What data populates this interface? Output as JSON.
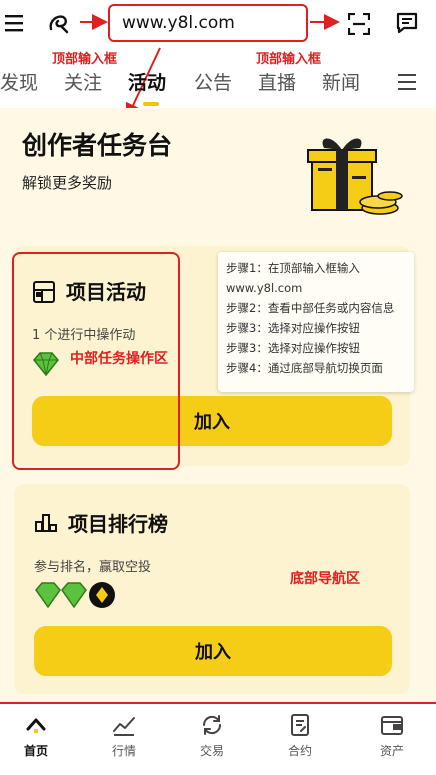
{
  "topbar": {
    "menu_icon": "hamburger-icon",
    "logo_icon": "swirl-logo-icon",
    "url": "www.y8l.com",
    "scan_icon": "scan-icon",
    "message_icon": "message-icon"
  },
  "annotations": {
    "top_input_left": "顶部输入框",
    "top_input_right": "顶部输入框",
    "middle_area": "中部任务操作区",
    "bottom_nav": "底部导航区",
    "color": "#e02020"
  },
  "tabs": [
    {
      "label": "发现"
    },
    {
      "label": "关注"
    },
    {
      "label": "活动"
    },
    {
      "label": "公告"
    },
    {
      "label": "直播"
    },
    {
      "label": "新闻"
    }
  ],
  "tabs_menu_icon": "hamburger-icon",
  "hero": {
    "title": "创作者任务台",
    "subtitle": "解锁更多奖励"
  },
  "cards": [
    {
      "icon": "project-board-icon",
      "title": "项目活动",
      "desc": "1 个进行中操作动",
      "button": "加入"
    },
    {
      "icon": "ranking-bars-icon",
      "title": "项目排行榜",
      "desc": "参与排名，赢取空投",
      "button": "加入"
    }
  ],
  "steps": [
    "步骤1：在顶部输入框输入",
    "www.y8l.com",
    "步骤2：查看中部任务或内容信息",
    "步骤3：选择对应操作按钮",
    "步骤3：选择对应操作按钮",
    "步骤4：通过底部导航切换页面"
  ],
  "bottom_nav": [
    {
      "label": "首页",
      "icon": "home-chevron-icon",
      "active": true
    },
    {
      "label": "行情",
      "icon": "chart-line-icon",
      "active": false
    },
    {
      "label": "交易",
      "icon": "exchange-icon",
      "active": false
    },
    {
      "label": "合约",
      "icon": "contract-doc-icon",
      "active": false
    },
    {
      "label": "资产",
      "icon": "wallet-icon",
      "active": false
    }
  ],
  "colors": {
    "accent": "#f5cc16",
    "card": "#fdf3d0",
    "background": "#fff8e5"
  }
}
